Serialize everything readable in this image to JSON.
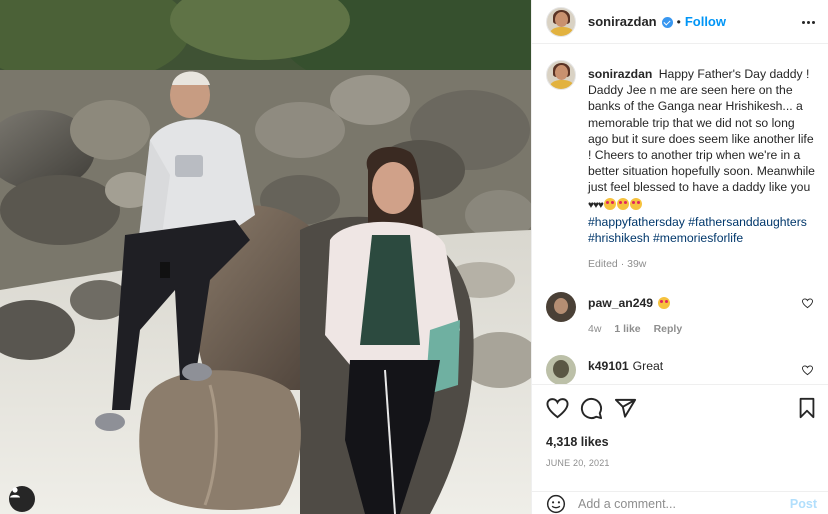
{
  "post": {
    "username": "sonirazdan",
    "follow_label": "Follow",
    "separator": "•",
    "caption": "Happy Father's Day daddy ! Daddy Jee n me are seen here on the banks of the Ganga near Hrishikesh... a memorable trip that we did not so long ago but it sure does seem like another life ! Cheers to another trip when we're in a better situation hopefully soon. Meanwhile just feel blessed to have a daddy like you",
    "caption_emoji": "♥♥♥",
    "hashtags": "#happyfathersday #fathersanddaughters #hrishikesh #memoriesforlife",
    "edited": "Edited · 39w",
    "likes": "4,318 likes",
    "date": "JUNE 20, 2021"
  },
  "comments": [
    {
      "username": "paw_an249",
      "text": "",
      "age": "4w",
      "likes": "1 like",
      "reply": "Reply"
    },
    {
      "username": "k49101",
      "text": "Great"
    }
  ],
  "composer": {
    "placeholder": "Add a comment...",
    "post_label": "Post"
  },
  "icons": {
    "more": "more-options-icon",
    "like": "heart-icon",
    "comment": "comment-icon",
    "share": "share-icon",
    "save": "bookmark-icon",
    "emoji": "emoji-icon",
    "tag": "user-tag-icon"
  },
  "colors": {
    "accent": "#0095f6",
    "hashtag": "#00376b",
    "muted": "#8e8e8e",
    "post_disabled": "#b2dffc"
  }
}
